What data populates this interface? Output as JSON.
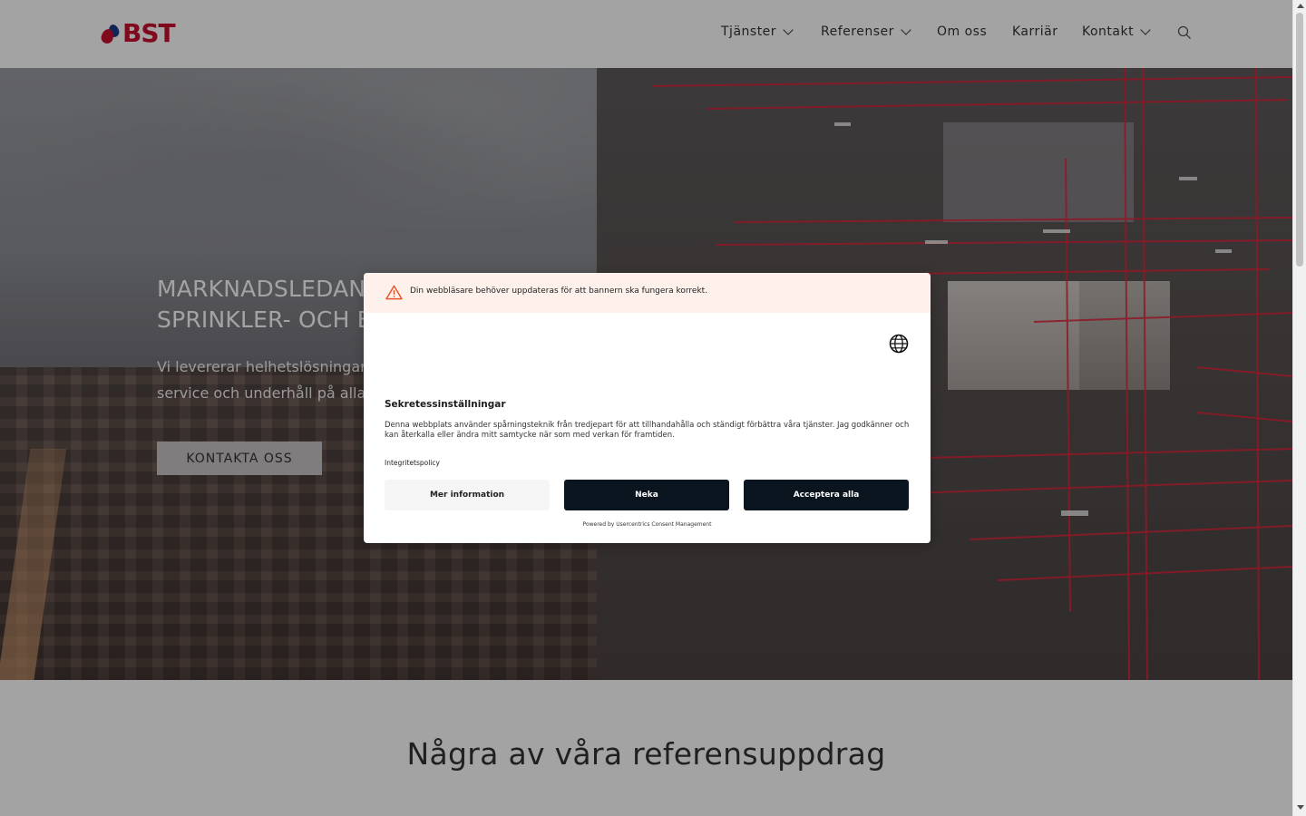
{
  "header": {
    "logo_text": "BST",
    "nav": [
      {
        "label": "Tjänster",
        "has_dropdown": true
      },
      {
        "label": "Referenser",
        "has_dropdown": true
      },
      {
        "label": "Om oss",
        "has_dropdown": false
      },
      {
        "label": "Karriär",
        "has_dropdown": false
      },
      {
        "label": "Kontakt",
        "has_dropdown": true
      }
    ],
    "search_icon": "search-icon"
  },
  "hero": {
    "title_line1": "MARKNADSLEDAND",
    "title_line2": "SPRINKLER- OCH BI",
    "sub_line1": "Vi levererar helhetslösningar",
    "sub_line2": "service och underhåll på alla",
    "cta_label": "KONTAKTA OSS"
  },
  "section": {
    "title": "Några av våra referensuppdrag"
  },
  "consent": {
    "warning_text": "Din webbläsare behöver uppdateras för att bannern ska fungera korrekt.",
    "title": "Sekretessinställningar",
    "body": "Denna webbplats använder spårningsteknik från tredjepart för att tillhandahålla och ständigt förbättra våra tjänster. Jag godkänner och kan återkalla eller ändra mitt samtycke när som med verkan för framtiden.",
    "policy_link": "Integritetspolicy",
    "buttons": {
      "more": "Mer information",
      "deny": "Neka",
      "accept": "Acceptera alla"
    },
    "powered_by": "Powered by Usercentrics Consent Management"
  },
  "colors": {
    "brand_red": "#c8102e",
    "brand_blue": "#1e3a8a",
    "dialog_button_dark": "#0a1520",
    "warning_bg": "#fef1ec",
    "warning_icon": "#e8542b"
  }
}
